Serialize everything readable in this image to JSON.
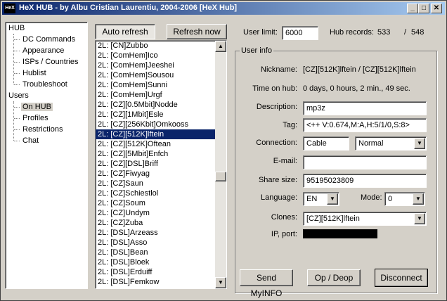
{
  "window": {
    "title": "HeX HUB - by Albu Cristian Laurentiu, 2004-2006 [HeX Hub]",
    "icon_label": "HeX",
    "buttons": {
      "minimize": "_",
      "maximize": "□",
      "close": "✕"
    }
  },
  "tree": {
    "hub_group": "HUB",
    "hub_items": [
      "DC Commands",
      "Appearance",
      "ISPs / Countries",
      "Hublist",
      "Troubleshoot"
    ],
    "users_group": "Users",
    "user_items": [
      "On HUB",
      "Profiles",
      "Restrictions",
      "Chat"
    ],
    "selected": "On HUB"
  },
  "toolbar": {
    "auto_refresh": "Auto refresh",
    "refresh_now": "Refresh now",
    "user_limit_label": "User limit:",
    "user_limit_value": "6000",
    "hub_records_label": "Hub records:",
    "hub_records_value": "533",
    "hub_records_sep": "/",
    "hub_records_total": "548"
  },
  "user_list": {
    "rows": [
      "2L: [CN]Zubbo",
      "2L: [ComHem]Ico",
      "2L: [ComHem]Jeeshei",
      "2L: [ComHem]Sousou",
      "2L: [ComHem]Sunni",
      "2L: [ComHem]Urgf",
      "2L: [CZ][0.5Mbit]Nodde",
      "2L: [CZ][1Mbit]Esle",
      "2L: [CZ][256Kbit]Omkooss",
      "2L: [CZ][512K]lftein",
      "2L: [CZ][512K]Oftean",
      "2L: [CZ][5Mbit]Enfch",
      "2L: [CZ][DSL]Briff",
      "2L: [CZ]Fiwyag",
      "2L: [CZ]Saun",
      "2L: [CZ]Schiestlol",
      "2L: [CZ]Soum",
      "2L: [CZ]Undym",
      "2L: [CZ]Zuba",
      "2L: [DSL]Arzeass",
      "2L: [DSL]Asso",
      "2L: [DSL]Bean",
      "2L: [DSL]Bloek",
      "2L: [DSL]Erduiff",
      "2L: [DSL]Femkow"
    ],
    "selected_index": 9
  },
  "user_info": {
    "group_title": "User info",
    "nickname_label": "Nickname:",
    "nickname_value": "[CZ][512K]lftein / [CZ][512K]lftein",
    "time_label": "Time on hub:",
    "time_value": "0 days, 0 hours, 2 min., 49 sec.",
    "description_label": "Description:",
    "description_value": "mp3z",
    "tag_label": "Tag:",
    "tag_value": "<++ V:0.674,M:A,H:5/1/0,S:8>",
    "connection_label": "Connection:",
    "connection_value": "Cable",
    "connection_type": "Normal",
    "email_label": "E-mail:",
    "email_value": "",
    "share_label": "Share size:",
    "share_value": "95195023809",
    "language_label": "Language:",
    "language_value": "EN",
    "mode_label": "Mode:",
    "mode_value": "0",
    "clones_label": "Clones:",
    "clones_value": "[CZ][512K]lftein",
    "ip_label": "IP, port:"
  },
  "actions": {
    "send_myinfo": "Send MyINFO",
    "op_deop": "Op / Deop",
    "disconnect": "Disconnect"
  },
  "icons": {
    "dropdown": "▼",
    "scroll_up": "▲",
    "scroll_down": "▼"
  }
}
